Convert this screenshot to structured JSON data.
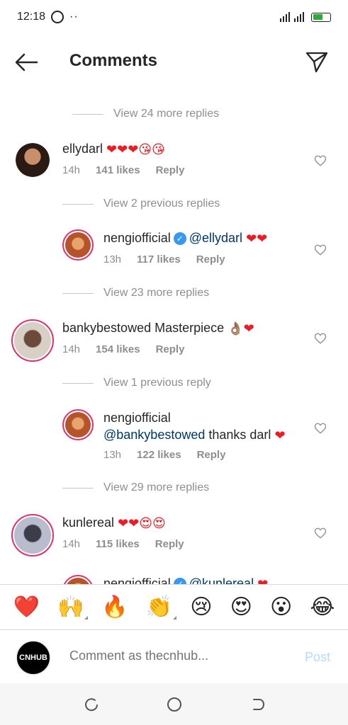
{
  "status": {
    "time": "12:18",
    "dots": "··"
  },
  "header": {
    "title": "Comments"
  },
  "dividers": [
    "View 24 more replies",
    "View 2 previous replies",
    "View 23 more replies",
    "View 1 previous reply",
    "View 29 more replies"
  ],
  "comments": [
    {
      "user": "ellydarl",
      "text": "",
      "emoji": "❤❤❤😘😘",
      "time": "14h",
      "likes": "141 likes",
      "reply": "Reply"
    },
    {
      "user": "nengiofficial",
      "mention": "@ellydarl",
      "emoji": "❤❤",
      "time": "13h",
      "likes": "117 likes",
      "reply": "Reply"
    },
    {
      "user": "bankybestowed",
      "text": "Masterpiece",
      "emoji": "👌🏽❤",
      "time": "14h",
      "likes": "154 likes",
      "reply": "Reply"
    },
    {
      "user": "nengiofficial",
      "mention": "@bankybestowed",
      "text": "thanks darl",
      "emoji": "❤",
      "time": "13h",
      "likes": "122 likes",
      "reply": "Reply"
    },
    {
      "user": "kunlereal",
      "text": "",
      "emoji": "❤❤😍😍",
      "time": "14h",
      "likes": "115 likes",
      "reply": "Reply"
    },
    {
      "user": "nengiofficial",
      "mention": "@kunlereal",
      "emoji": "❤"
    }
  ],
  "reactions": [
    "❤️",
    "🙌",
    "🔥",
    "👏",
    "😢",
    "😍",
    "😮",
    "😂"
  ],
  "composer": {
    "avatar_text": "CNHUB",
    "placeholder": "Comment as thecnhub...",
    "post": "Post"
  },
  "colors": {
    "link": "#00376b",
    "verified": "#3897f0",
    "post_disabled": "#b3dbff",
    "heart": "#ed1c24"
  }
}
